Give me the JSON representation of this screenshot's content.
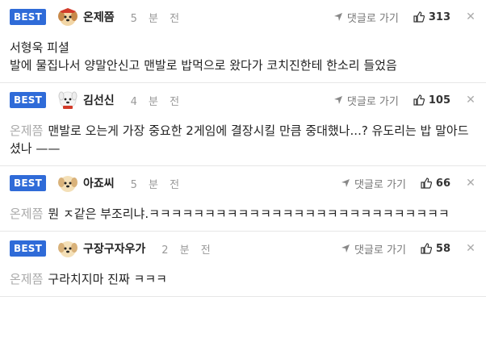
{
  "comments": [
    {
      "badge": "BEST",
      "author": "온제쯤",
      "time": "5 분 전",
      "reply_label": "댓글로 가기",
      "likes": "313",
      "mention": "",
      "text": "서형욱 피셜\n발에 물집나서 양말안신고 맨발로 밥먹으로 왔다가 코치진한테 한소리 들었음",
      "avatar": "puppy-red-avatar"
    },
    {
      "badge": "BEST",
      "author": "김선신",
      "time": "4 분 전",
      "reply_label": "댓글로 가기",
      "likes": "105",
      "mention": "온제쯤",
      "text": "맨발로 오는게 가장 중요한 2게임에 결장시킬 만큼 중대했나...? 유도리는 밥 말아드셨나 ——",
      "avatar": "white-dog-avatar"
    },
    {
      "badge": "BEST",
      "author": "아죠씨",
      "time": "5 분 전",
      "reply_label": "댓글로 가기",
      "likes": "66",
      "mention": "온제쯤",
      "text": "뭔 ㅈ같은 부조리냐.ㅋㅋㅋㅋㅋㅋㅋㅋㅋㅋㅋㅋㅋㅋㅋㅋㅋㅋㅋㅋㅋㅋㅋㅋㅋㅋㅋ",
      "avatar": "puppy-beige-avatar"
    },
    {
      "badge": "BEST",
      "author": "구장구자우가",
      "time": "2 분 전",
      "reply_label": "댓글로 가기",
      "likes": "58",
      "mention": "온제쯤",
      "text": "구라치지마 진짜 ㅋㅋㅋ",
      "avatar": "puppy-beige-avatar"
    }
  ],
  "colors": {
    "badge": "#2f6bd8",
    "mention": "#aaaaaa"
  }
}
